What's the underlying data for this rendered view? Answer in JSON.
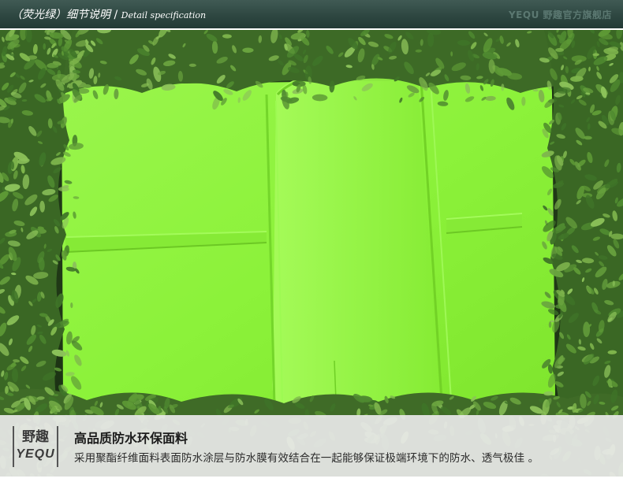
{
  "header": {
    "title": "（荧光绿）细节说明",
    "separator": " / ",
    "subtitle": "Detail specification",
    "watermark": "YEQU 野趣官方旗舰店"
  },
  "photo": {
    "subject": "fluorescent-green raincoat fabric",
    "fabric_color": "#8cf23a",
    "foliage_color": "#5a8f3a"
  },
  "caption": {
    "logo_cn": "野趣",
    "logo_en": "YEQU",
    "title": "高品质防水环保面料",
    "description": "采用聚酯纤维面料表面防水涂层与防水膜有效结合在一起能够保证极端环境下的防水、透气极佳 。"
  }
}
